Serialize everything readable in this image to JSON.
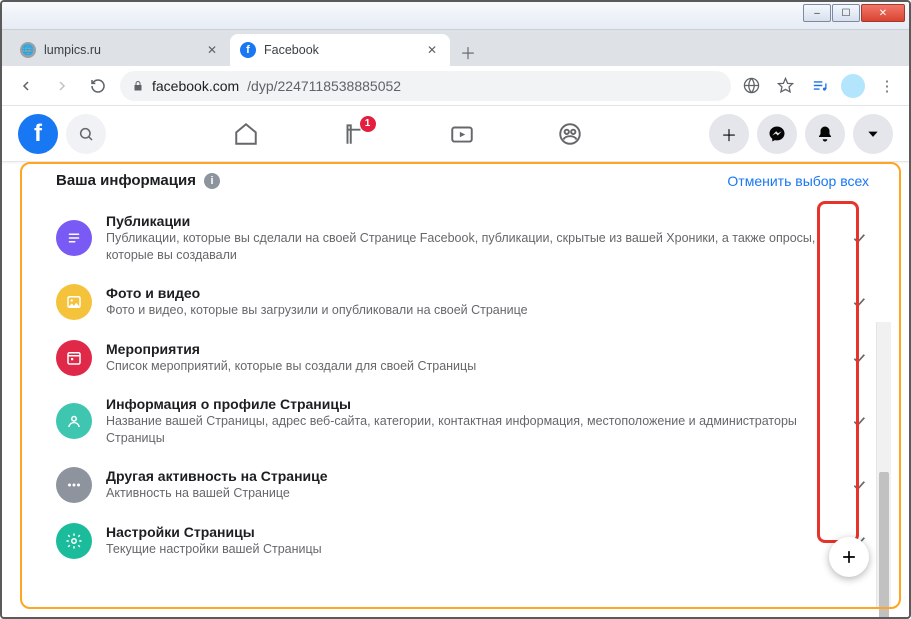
{
  "window": {
    "minimize": "–",
    "maximize": "☐",
    "close": "✕"
  },
  "tabs": [
    {
      "title": "lumpics.ru",
      "active": false
    },
    {
      "title": "Facebook",
      "active": true
    }
  ],
  "url": {
    "origin": "facebook.com",
    "path": "/dyp/2247118538885052"
  },
  "fb_header": {
    "notif_badge": "1"
  },
  "section": {
    "heading": "Ваша информация",
    "deselect_all": "Отменить выбор всех"
  },
  "items": [
    {
      "icon_bg": "#7a5af5",
      "title": "Публикации",
      "desc": "Публикации, которые вы сделали на своей Странице Facebook, публикации, скрытые из вашей Хроники, а также опросы, которые вы создавали",
      "checked": true
    },
    {
      "icon_bg": "#f5c33b",
      "title": "Фото и видео",
      "desc": "Фото и видео, которые вы загрузили и опубликовали на своей Странице",
      "checked": true
    },
    {
      "icon_bg": "#e02849",
      "title": "Мероприятия",
      "desc": "Список мероприятий, которые вы создали для своей Страницы",
      "checked": true
    },
    {
      "icon_bg": "#3ec6b1",
      "title": "Информация о профиле Страницы",
      "desc": "Название вашей Страницы, адрес веб-сайта, категории, контактная информация, местоположение и администраторы Страницы",
      "checked": true
    },
    {
      "icon_bg": "#8d949e",
      "title": "Другая активность на Странице",
      "desc": "Активность на вашей Странице",
      "checked": true
    },
    {
      "icon_bg": "#1abc9c",
      "title": "Настройки Страницы",
      "desc": "Текущие настройки вашей Страницы",
      "checked": true
    }
  ]
}
